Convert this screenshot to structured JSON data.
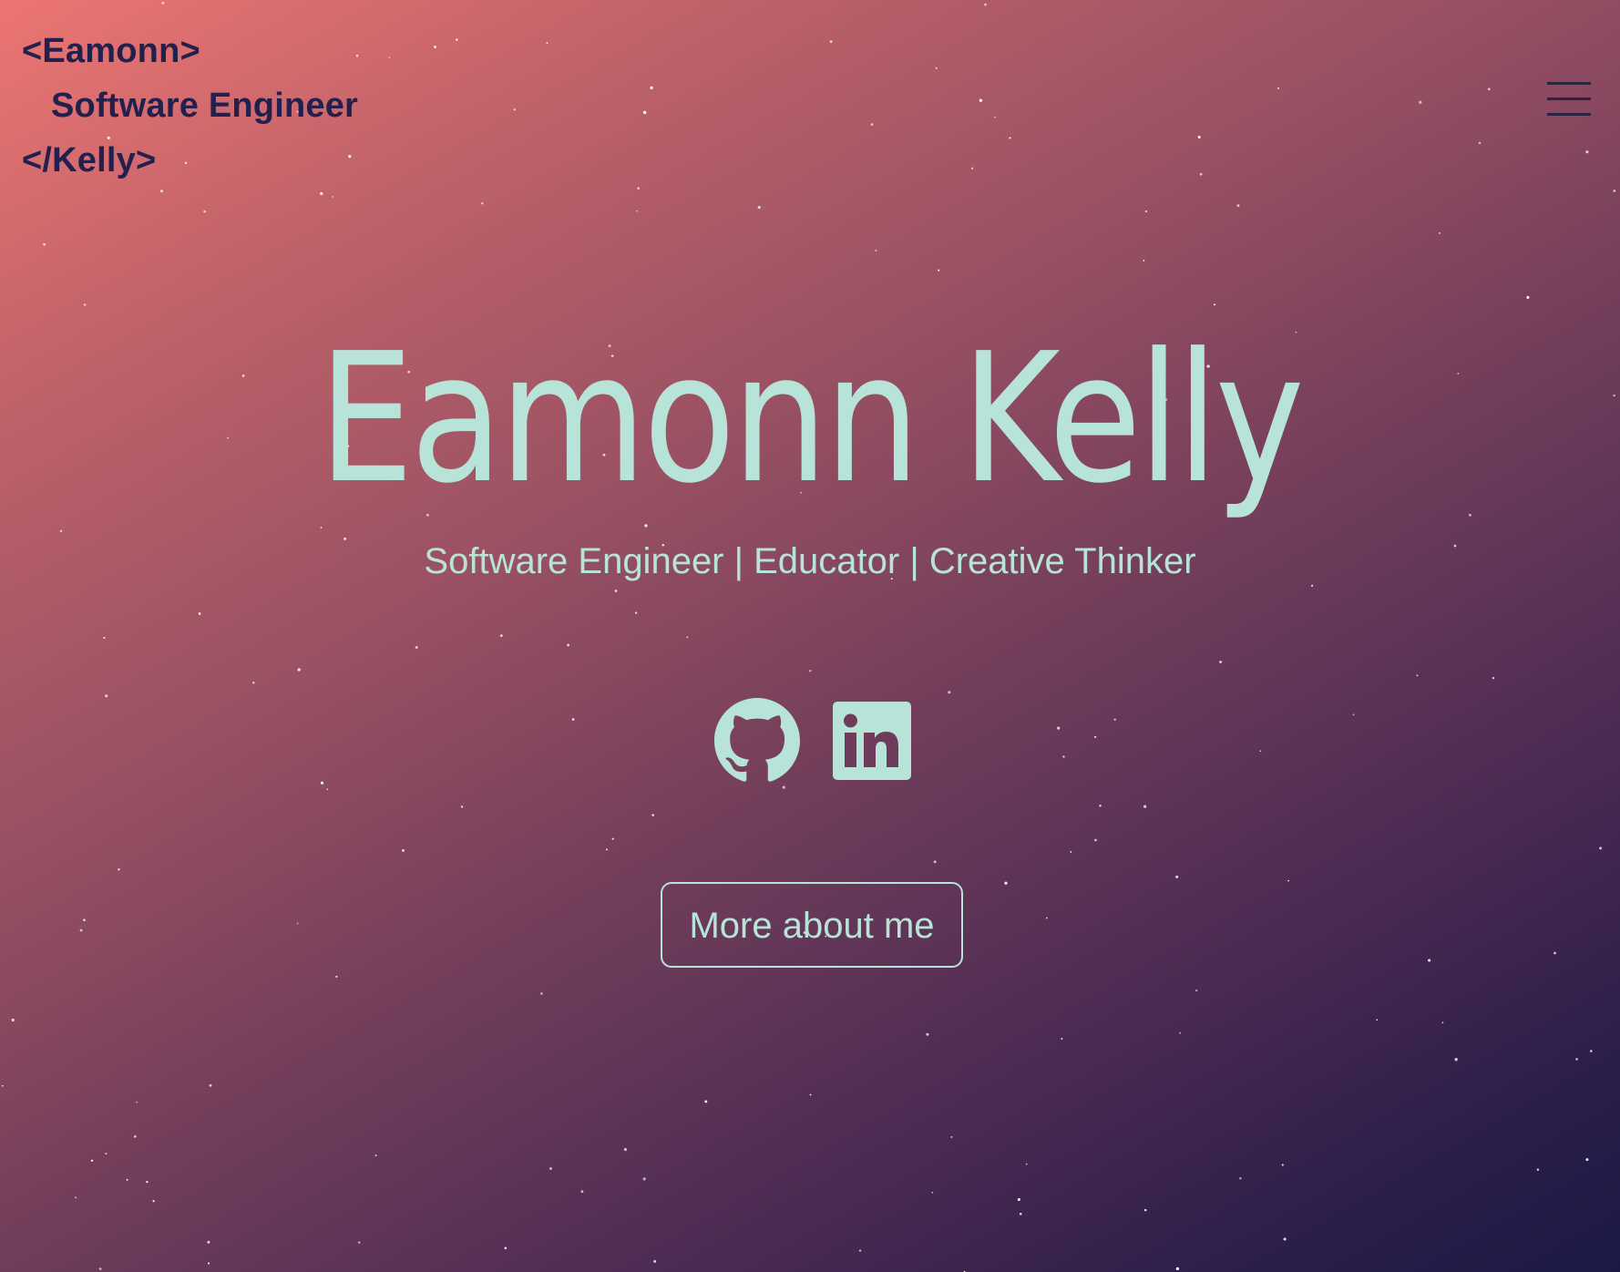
{
  "header": {
    "logo_open": "<Eamonn>",
    "logo_role": "Software Engineer",
    "logo_close": "</Kelly>",
    "menu_icon": "hamburger-menu-icon"
  },
  "hero": {
    "name": "Eamonn Kelly",
    "tagline": "Software Engineer | Educator | Creative Thinker",
    "social": [
      {
        "name": "GitHub",
        "icon": "github-icon"
      },
      {
        "name": "LinkedIn",
        "icon": "linkedin-icon"
      }
    ],
    "cta_label": "More about me"
  },
  "colors": {
    "accent": "#b8e3d8",
    "logo_text": "#24204d",
    "gradient_start": "#ec7572",
    "gradient_end": "#1b1a45"
  }
}
